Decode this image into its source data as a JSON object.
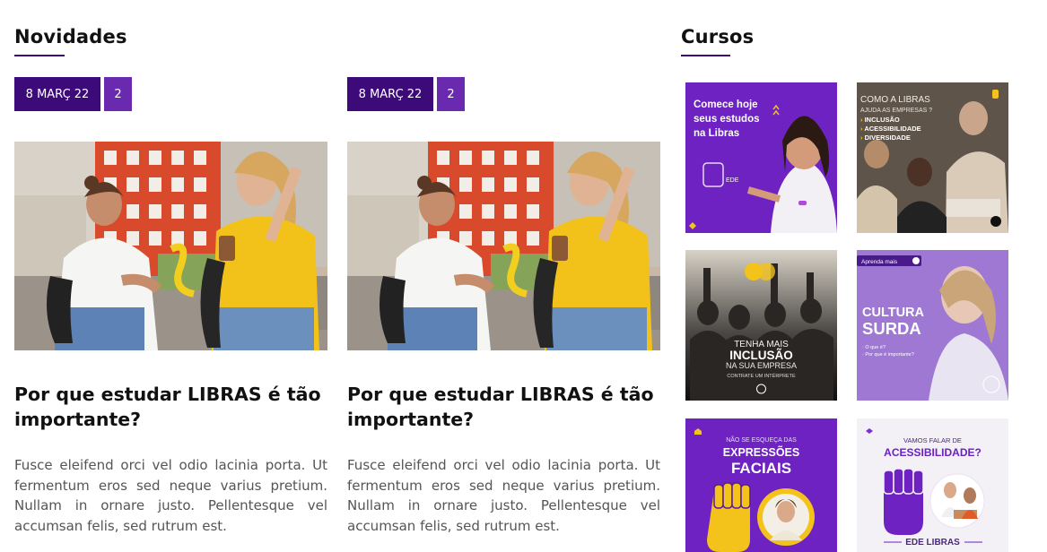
{
  "news": {
    "heading": "Novidades",
    "posts": [
      {
        "date": "8 MARÇ 22",
        "count": "2",
        "title": "Por que estudar LIBRAS é tão importante?",
        "excerpt": "Fusce eleifend orci vel odio lacinia porta. Ut fermentum eros sed neque varius pretium. Nullam in ornare justo. Pellentesque vel accumsan felis, sed rutrum est."
      },
      {
        "date": "8 MARÇ 22",
        "count": "2",
        "title": "Por que estudar LIBRAS é tão importante?",
        "excerpt": "Fusce eleifend orci vel odio lacinia porta. Ut fermentum eros sed neque varius pretium. Nullam in ornare justo. Pellentesque vel accumsan felis, sed rutrum est."
      }
    ]
  },
  "courses": {
    "heading": "Cursos",
    "cards": [
      {
        "lines": [
          "Comece hoje",
          "seus estudos",
          "na Libras"
        ],
        "brand": "EDE"
      },
      {
        "lines": [
          "COMO A LIBRAS",
          "AJUDA AS EMPRESAS ?"
        ],
        "bullets": [
          "INCLUSÃO",
          "ACESSIBILIDADE",
          "DIVERSIDADE"
        ]
      },
      {
        "lines": [
          "TENHA MAIS",
          "INCLUSÃO",
          "NA SUA EMPRESA"
        ],
        "footer": "CONTRATE UM INTÉRPRETE"
      },
      {
        "tag": "Aprenda mais",
        "lines": [
          "CULTURA",
          "SURDA"
        ],
        "bullets": [
          "O que é?",
          "Por que é importante?"
        ]
      },
      {
        "lines": [
          "NÃO SE ESQUEÇA DAS",
          "EXPRESSÕES",
          "FACIAIS"
        ]
      },
      {
        "lines": [
          "VAMOS FALAR DE",
          "ACESSIBILIDADE?"
        ],
        "footer": "EDE LIBRAS"
      }
    ]
  },
  "colors": {
    "accent_dark": "#3d0a7a",
    "accent": "#6a2ab0",
    "course_purple": "#6f22c2",
    "yellow": "#f3c21b"
  }
}
